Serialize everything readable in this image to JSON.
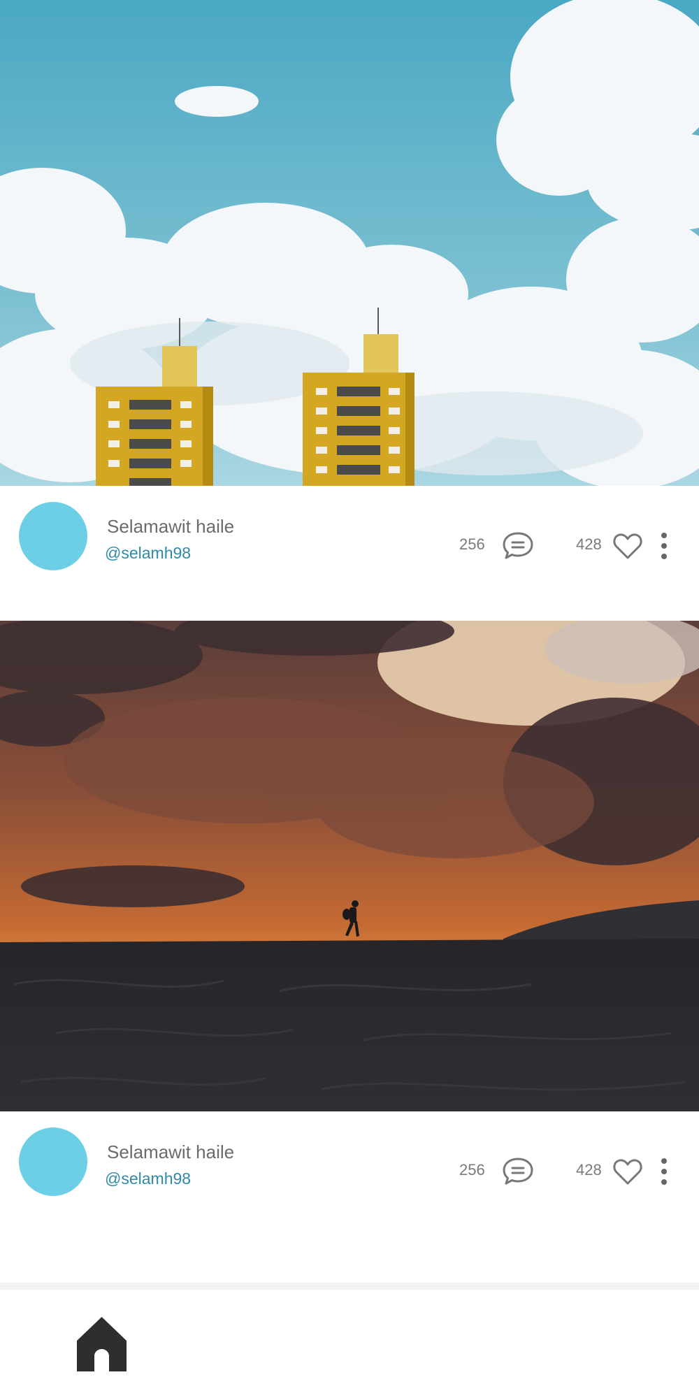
{
  "feed": {
    "posts": [
      {
        "image": "yellow-towers-against-blue-sky",
        "user_name": "Selamawit haile",
        "user_handle": "@selamh98",
        "comment_count": "256",
        "like_count": "428"
      },
      {
        "image": "hiker-silhouette-stormy-sunset",
        "user_name": "Selamawit haile",
        "user_handle": "@selamh98",
        "comment_count": "256",
        "like_count": "428"
      }
    ]
  },
  "icons": {
    "comment": "comment-icon",
    "like": "heart-icon",
    "more": "more-vertical-icon",
    "home": "home-icon"
  },
  "colors": {
    "avatar": "#6dcfe6",
    "handle": "#2e8aa6",
    "name": "#6b6b6b",
    "nav_icon": "#2e2e2e"
  }
}
